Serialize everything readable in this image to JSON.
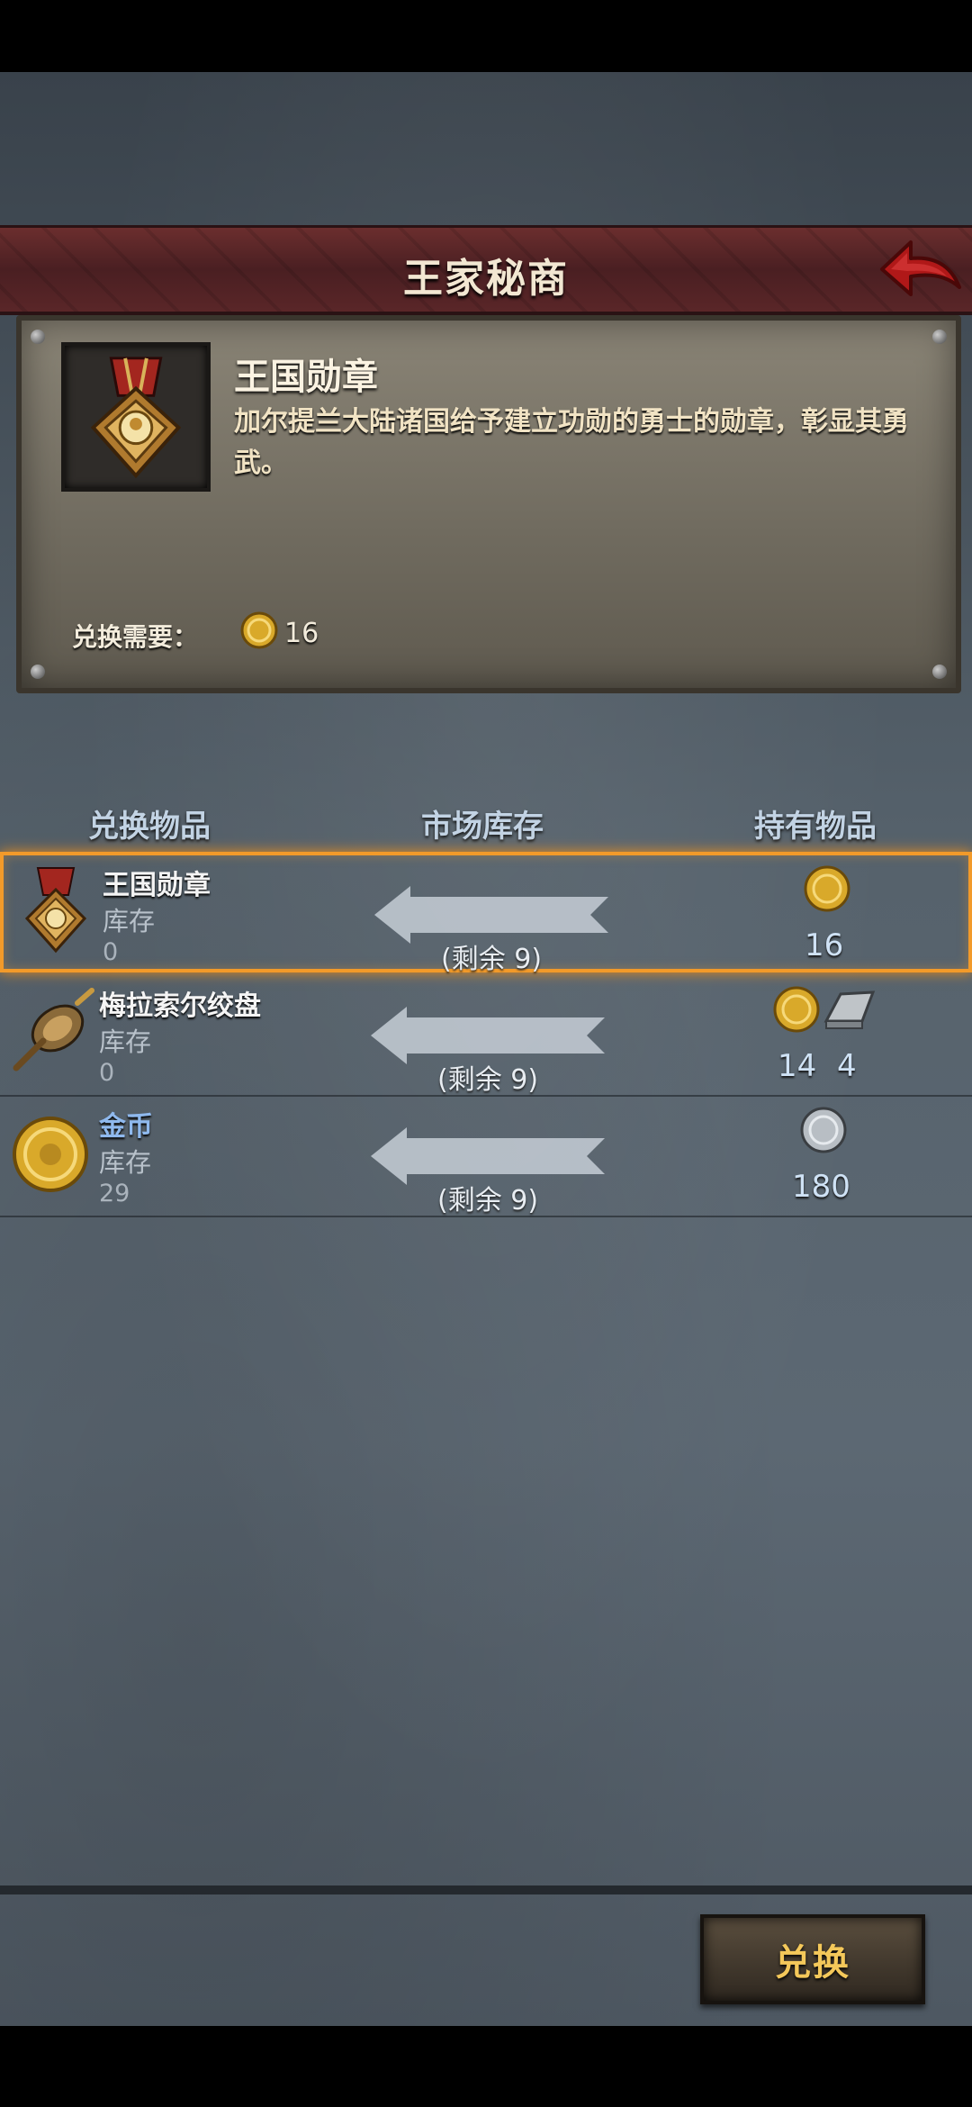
{
  "header": {
    "title": "王家秘商",
    "back_icon": "back-arrow-icon"
  },
  "detail": {
    "item_name": "王国勋章",
    "description": "加尔提兰大陆诸国给予建立功勋的勇士的勋章，彰显其勇武。",
    "cost_label": "兑换需要：",
    "cost_value": "16",
    "cost_icon": "gold-coin-icon"
  },
  "columns": {
    "exchange_item": "兑换物品",
    "market_stock": "市场库存",
    "owned_items": "持有物品"
  },
  "rows": [
    {
      "name": "王国勋章",
      "stock_label": "库存",
      "stock_value": "0",
      "remaining": "(剩余 9)",
      "owned_values": [
        "16"
      ],
      "icon": "medal-icon",
      "owned_icons": [
        "gold-coin-icon"
      ],
      "selected": true
    },
    {
      "name": "梅拉索尔绞盘",
      "stock_label": "库存",
      "stock_value": "0",
      "remaining": "(剩余 9)",
      "owned_values": [
        "14",
        "4"
      ],
      "icon": "winch-icon",
      "owned_icons": [
        "gold-coin-icon",
        "iron-ingot-icon"
      ],
      "selected": false
    },
    {
      "name": "金币",
      "stock_label": "库存",
      "stock_value": "29",
      "remaining": "(剩余 9)",
      "owned_values": [
        "180"
      ],
      "icon": "gold-coin-icon",
      "owned_icons": [
        "silver-coin-icon"
      ],
      "selected": false
    }
  ],
  "footer": {
    "exchange_label": "兑换"
  },
  "colors": {
    "accent": "#f29a2a",
    "banner": "#5a2628",
    "button_text": "#f4c85a"
  }
}
